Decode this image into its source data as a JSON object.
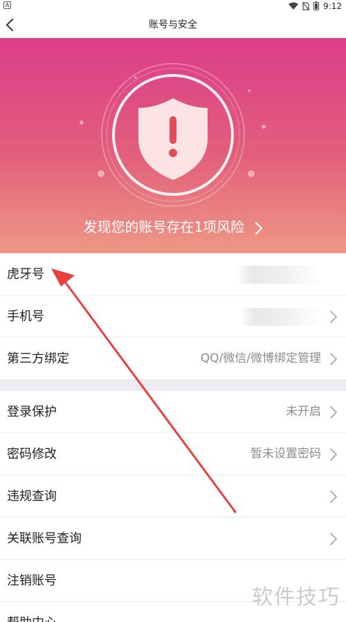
{
  "status_bar": {
    "app_badge": "A",
    "time": "9:12"
  },
  "nav": {
    "title": "账号与安全"
  },
  "hero": {
    "risk_text": "发现您的账号存在1项风险"
  },
  "rows_group1": [
    {
      "label": "虎牙号",
      "value": ""
    },
    {
      "label": "手机号",
      "value": ""
    },
    {
      "label": "第三方绑定",
      "value": "QQ/微信/微博绑定管理"
    }
  ],
  "rows_group2": [
    {
      "label": "登录保护",
      "value": "未开启"
    },
    {
      "label": "密码修改",
      "value": "暂未设置密码"
    },
    {
      "label": "违规查询",
      "value": ""
    },
    {
      "label": "关联账号查询",
      "value": ""
    },
    {
      "label": "注销账号",
      "value": ""
    },
    {
      "label": "帮助中心",
      "value": ""
    }
  ],
  "watermark": "软件技巧",
  "colors": {
    "hero_top": "#dc3d8a",
    "hero_bottom": "#ee9884",
    "annotation_arrow": "#e8403f"
  },
  "icons": [
    "back-arrow-icon",
    "wifi-icon",
    "no-sim-icon",
    "battery-icon",
    "shield-alert-icon",
    "chevron-right-icon"
  ]
}
